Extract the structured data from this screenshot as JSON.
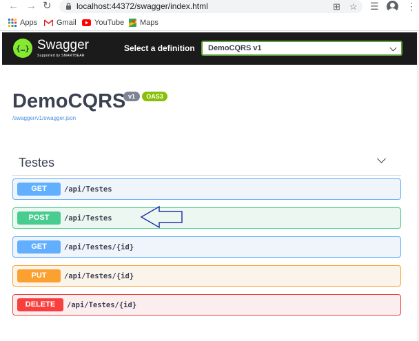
{
  "browser": {
    "url": "localhost:44372/swagger/index.html",
    "bookmarks": [
      {
        "label": "Apps",
        "icon": "apps-grid-icon"
      },
      {
        "label": "Gmail",
        "icon": "gmail-icon"
      },
      {
        "label": "YouTube",
        "icon": "youtube-icon"
      },
      {
        "label": "Maps",
        "icon": "maps-icon"
      }
    ]
  },
  "topbar": {
    "brand": "Swagger",
    "brand_sub": "Supported by SMARTBEAR",
    "select_label": "Select a definition",
    "select_value": "DemoCQRS v1",
    "accent": "#85ea2d"
  },
  "info": {
    "title": "DemoCQRS",
    "version_badge": "v1",
    "oas_badge": "OAS3",
    "spec_link": "/swagger/v1/swagger.json"
  },
  "tag": {
    "name": "Testes"
  },
  "operations": [
    {
      "method": "GET",
      "path": "/api/Testes",
      "color": "#61affe"
    },
    {
      "method": "POST",
      "path": "/api/Testes",
      "color": "#49cc90"
    },
    {
      "method": "GET",
      "path": "/api/Testes/{id}",
      "color": "#61affe"
    },
    {
      "method": "PUT",
      "path": "/api/Testes/{id}",
      "color": "#fca130"
    },
    {
      "method": "DELETE",
      "path": "/api/Testes/{id}",
      "color": "#f93e3e"
    }
  ]
}
